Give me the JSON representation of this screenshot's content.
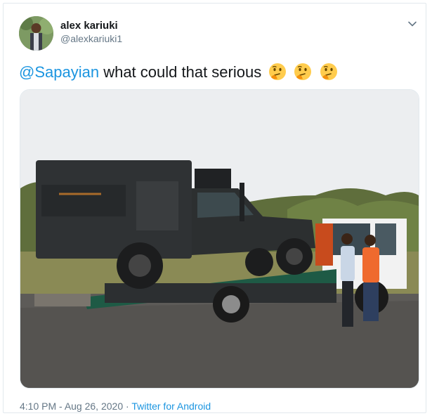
{
  "user": {
    "display_name": "alex kariuki",
    "handle": "@alexkariuki1"
  },
  "tweet": {
    "mention": "@Sapayian",
    "text": " what could that serious",
    "emojis": [
      "thinking-face-icon",
      "thinking-face-icon",
      "thinking-face-icon"
    ]
  },
  "photo": {
    "subject": "safari camper truck on a flatbed tow truck"
  },
  "meta": {
    "time": "4:10 PM",
    "separator": " · ",
    "date": "Aug 26, 2020",
    "source": "Twitter for Android"
  },
  "colors": {
    "link": "#1b95e0",
    "muted": "#657786",
    "border": "#e1e8ed"
  }
}
